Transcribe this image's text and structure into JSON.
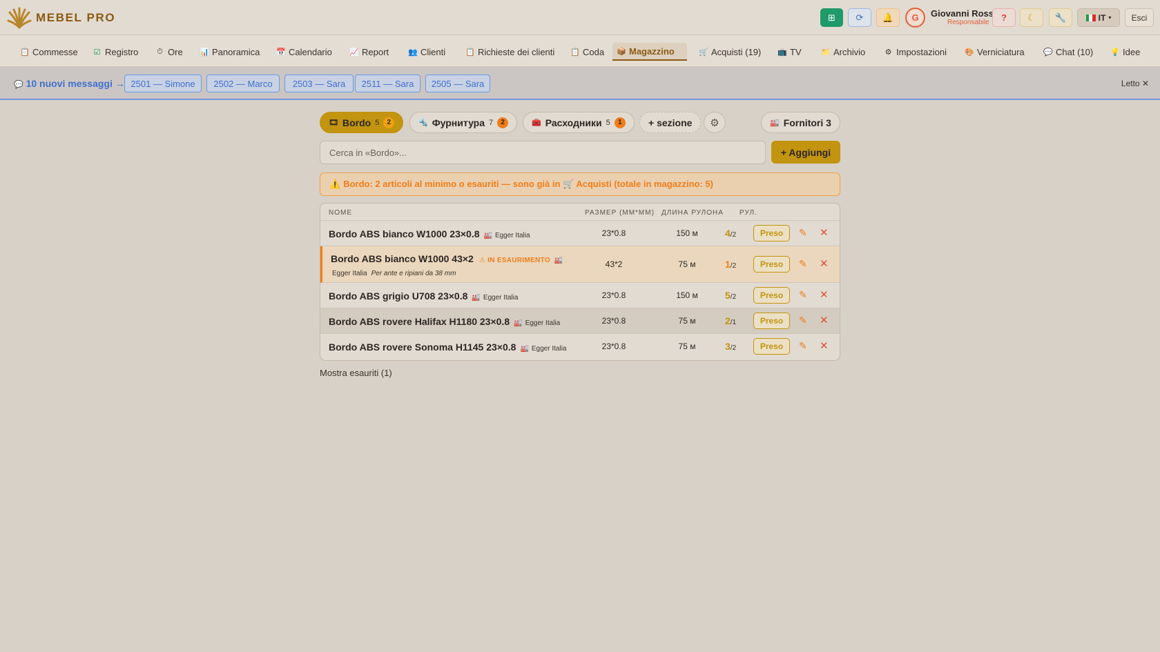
{
  "header": {
    "brand": "MEBEL PRO",
    "user_name": "Giovanni Rossi",
    "user_role": "Responsabile",
    "avatar_initial": "G",
    "language": "IT",
    "logout_label": "Esci",
    "help_label": "?"
  },
  "nav": [
    {
      "label": "Commesse",
      "icon": "clipboard-icon"
    },
    {
      "label": "Registro",
      "icon": "checkbox-icon"
    },
    {
      "label": "Ore",
      "icon": "stopwatch-icon"
    },
    {
      "label": "Panoramica",
      "icon": "bar-chart-icon"
    },
    {
      "label": "Calendario",
      "icon": "calendar-icon"
    },
    {
      "label": "Report",
      "icon": "trend-chart-icon"
    },
    {
      "label": "Clienti",
      "icon": "people-icon"
    },
    {
      "label": "Richieste dei clienti",
      "icon": "clipboard-icon"
    },
    {
      "label": "Coda",
      "icon": "clipboard-icon"
    },
    {
      "label": "Magazzino",
      "icon": "package-icon"
    },
    {
      "label": "Acquisti (19)",
      "icon": "cart-icon"
    },
    {
      "label": "TV",
      "icon": "tv-icon"
    },
    {
      "label": "Archivio",
      "icon": "folder-icon"
    },
    {
      "label": "Impostazioni",
      "icon": "gear-icon"
    },
    {
      "label": "Verniciatura",
      "icon": "paint-icon"
    },
    {
      "label": "Chat (10)",
      "icon": "speech-bubble-icon"
    },
    {
      "label": "Idee",
      "icon": "lightbulb-icon"
    }
  ],
  "messages": {
    "title": "10 nuovi messaggi →",
    "chips": [
      "2501 — Simone",
      "2502 — Marco",
      "2503 — Sara",
      "2511 — Sara",
      "2505 — Sara"
    ],
    "read_label": "Letto"
  },
  "sections": {
    "tabs": [
      {
        "label": "Bordo",
        "count": "5",
        "badge": "2"
      },
      {
        "label": "Фурнитура",
        "count": "7",
        "badge": "2"
      },
      {
        "label": "Расходники",
        "count": "5",
        "badge": "1"
      }
    ],
    "add_section": "+ sezione",
    "suppliers": "Fornitori 3"
  },
  "search": {
    "placeholder": "Cerca in «Bordo»..."
  },
  "add_button": "+ Aggiungi",
  "alert": "Bordo: 2 articoli al minimo o esauriti — sono già in 🛒 Acquisti (totale in magazzino: 5)",
  "table": {
    "headers": {
      "name": "NOME",
      "size": "РАЗМЕР (ММ*ММ)",
      "length": "ДЛИНА РУЛОНА",
      "rolls": "РУЛ."
    },
    "rows": [
      {
        "name": "Bordo ABS bianco W1000 23×0.8",
        "supplier": "Egger Italia",
        "size": "23*0.8",
        "length": "150 м",
        "qty": "4",
        "min": "/2",
        "status": "",
        "note": ""
      },
      {
        "name": "Bordo ABS bianco W1000 43×2",
        "supplier": "Egger Italia",
        "size": "43*2",
        "length": "75 м",
        "qty": "1",
        "min": "/2",
        "status": "IN ESAURIMENTO",
        "note": "Per ante e ripiani da 38 mm"
      },
      {
        "name": "Bordo ABS grigio U708 23×0.8",
        "supplier": "Egger Italia",
        "size": "23*0.8",
        "length": "150 м",
        "qty": "5",
        "min": "/2",
        "status": "",
        "note": ""
      },
      {
        "name": "Bordo ABS rovere Halifax H1180 23×0.8",
        "supplier": "Egger Italia",
        "size": "23*0.8",
        "length": "75 м",
        "qty": "2",
        "min": "/1",
        "status": "",
        "note": ""
      },
      {
        "name": "Bordo ABS rovere Sonoma H1145 23×0.8",
        "supplier": "Egger Italia",
        "size": "23*0.8",
        "length": "75 м",
        "qty": "3",
        "min": "/2",
        "status": "",
        "note": ""
      }
    ],
    "action_label": "Preso"
  },
  "show_depleted": "Mostra esauriti (1)"
}
